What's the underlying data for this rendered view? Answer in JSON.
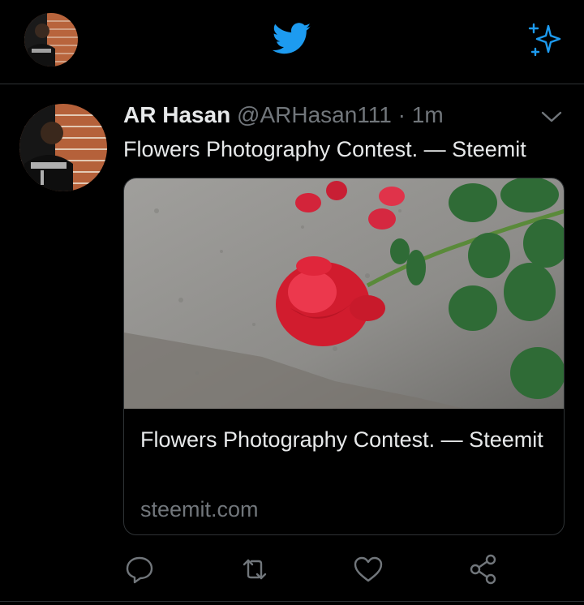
{
  "colors": {
    "background": "#000000",
    "accent": "#1d9bf0",
    "text": "#e7e9ea",
    "muted": "#71767b",
    "border": "#2f3336"
  },
  "header": {
    "logo_icon": "twitter-bird-icon",
    "sparkle_icon": "sparkle-icon"
  },
  "tweet": {
    "author_name": "AR Hasan",
    "handle": "@ARHasan111",
    "separator": " · ",
    "time": "1m",
    "text": "Flowers Photography Contest. — Steemit",
    "card": {
      "title": "Flowers Photography Contest. — Steemit",
      "domain": "steemit.com"
    }
  },
  "actions": [
    "reply-icon",
    "retweet-icon",
    "like-icon",
    "share-icon"
  ]
}
